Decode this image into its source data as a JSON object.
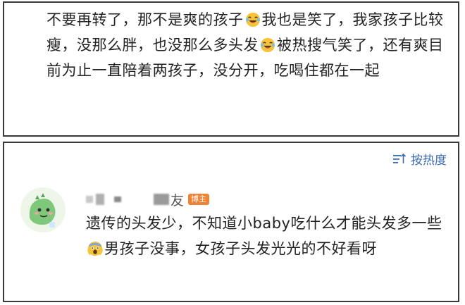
{
  "post": {
    "seg1": "不要再转了，那不是爽的孩子",
    "seg2": "我也是笑了，我家孩子比较瘦，没那么胖，也没那么多头发",
    "seg3": "被热搜气笑了，还有爽目前为止一直陪着两孩子，没分开，吃喝住都在一起",
    "emoji_icon": "laughing-tears-icon"
  },
  "comments": {
    "sort_label": "按热度",
    "sort_icon": "sort-lines-icon",
    "user": {
      "name_suffix": "友",
      "badge": "博主",
      "avatar_icon": "green-dinosaur-avatar"
    },
    "seg1": "遗传的头发少，不知道小baby吃什么才能头发多一些",
    "seg2": "男孩子没事，女孩子头发光光的不好看呀",
    "emoji_icon": "fearful-face-icon",
    "colors": {
      "link": "#3b6cb4",
      "badge": "#f08235",
      "emoji": "#f6c339"
    }
  }
}
